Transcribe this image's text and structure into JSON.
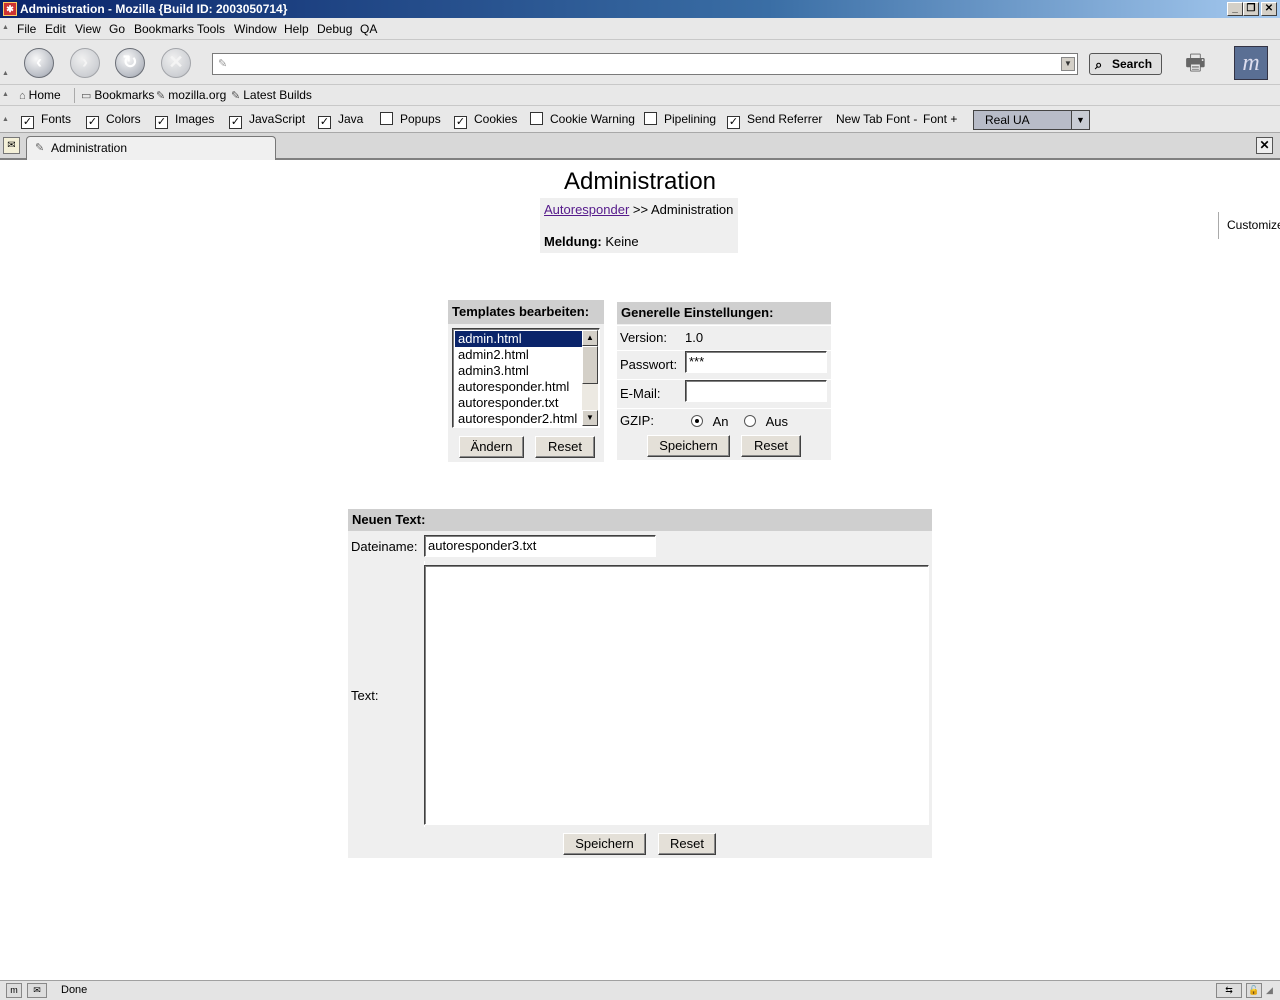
{
  "window": {
    "title": "Administration - Mozilla {Build ID: 2003050714}"
  },
  "menu": [
    "File",
    "Edit",
    "View",
    "Go",
    "Bookmarks",
    "Tools",
    "Window",
    "Help",
    "Debug",
    "QA"
  ],
  "nav": {
    "url_value": "",
    "search_label": "Search"
  },
  "personal_bar": {
    "home": "Home",
    "bookmarks": "Bookmarks",
    "mozilla": "mozilla.org",
    "latest": "Latest Builds"
  },
  "pref_bar": {
    "items": [
      {
        "label": "Fonts",
        "checked": true
      },
      {
        "label": "Colors",
        "checked": true
      },
      {
        "label": "Images",
        "checked": true
      },
      {
        "label": "JavaScript",
        "checked": true
      },
      {
        "label": "Java",
        "checked": true
      },
      {
        "label": "Popups",
        "checked": false
      },
      {
        "label": "Cookies",
        "checked": true
      },
      {
        "label": "Cookie Warning",
        "checked": false
      },
      {
        "label": "Pipelining",
        "checked": false
      },
      {
        "label": "Send Referrer",
        "checked": true
      }
    ],
    "new_tab": "New Tab",
    "font_minus": "Font -",
    "font_plus": "Font +",
    "ua_select": "Real UA",
    "customize": "Customize"
  },
  "tab": {
    "label": "Administration"
  },
  "page": {
    "title": "Administration",
    "breadcrumb_link": "Autoresponder",
    "breadcrumb_rest": ">> Administration",
    "message_label": "Meldung:",
    "message_value": "Keine"
  },
  "templates": {
    "header": "Templates bearbeiten:",
    "options": [
      "admin.html",
      "admin2.html",
      "admin3.html",
      "autoresponder.html",
      "autoresponder.txt",
      "autoresponder2.html"
    ],
    "selected": "admin.html",
    "edit_button": "Ändern",
    "reset_button": "Reset"
  },
  "general": {
    "header": "Generelle Einstellungen:",
    "version_label": "Version:",
    "version_value": "1.0",
    "password_label": "Passwort:",
    "password_value": "***",
    "email_label": "E-Mail:",
    "email_value": "",
    "gzip_label": "GZIP:",
    "gzip_on": "An",
    "gzip_off": "Aus",
    "gzip_selected": "An",
    "save_button": "Speichern",
    "reset_button": "Reset"
  },
  "new_text": {
    "header": "Neuen Text:",
    "filename_label": "Dateiname:",
    "filename_value": "autoresponder3.txt",
    "text_label": "Text:",
    "text_value": "",
    "save_button": "Speichern",
    "reset_button": "Reset"
  },
  "status": {
    "text": "Done"
  }
}
